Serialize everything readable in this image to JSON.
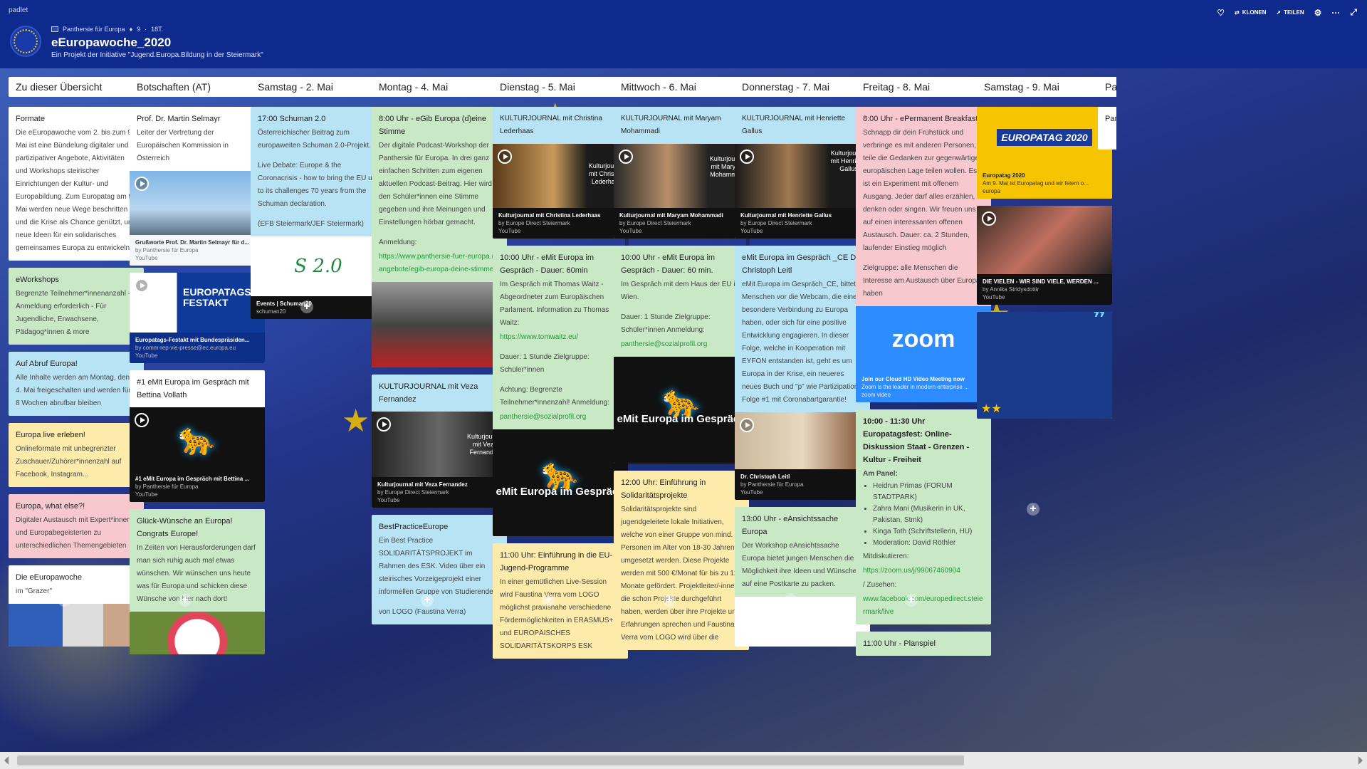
{
  "app": {
    "brand": "padlet"
  },
  "header": {
    "author": "Panthersie für Europa",
    "likes": "9",
    "age": "18T.",
    "title": "eEuropawoche_2020",
    "subtitle": "Ein Projekt der Initiative \"Jugend.Europa.Bildung in der Steiermark\"",
    "actions": {
      "clone": "KLONEN",
      "share": "TEILEN"
    }
  },
  "columns": [
    {
      "title": "Zu dieser Übersicht",
      "cards": [
        {
          "color": "white",
          "title": "Formate",
          "body": "Die eEuropawoche vom 2. bis zum 9. Mai ist eine Bündelung digitaler und partizipativer Angebote, Aktivitäten und Workshops steirischer Einrichtungen der Kultur- und Europabildung. Zum Europatag am 9. Mai werden neue Wege beschritten und die Krise als Chance genützt, um neue Ideen für ein solidarisches gemeinsames Europa zu entwickeln."
        },
        {
          "color": "green",
          "title": "eWorkshops",
          "body": "Begrenzte Teilnehmer*innenanzahl - Anmeldung erforderlich - Für Jugendliche, Erwachsene, Pädagog*innen & more"
        },
        {
          "color": "blue",
          "title": "Auf Abruf Europa!",
          "body": "Alle Inhalte werden am Montag, den 4. Mai freigeschalten und werden für 8 Wochen abrufbar bleiben"
        },
        {
          "color": "yellow",
          "title": "Europa live erleben!",
          "body": "Onlineformate mit unbegrenzter Zuschauer/Zuhörer*innenzahl auf Facebook, Instagram..."
        },
        {
          "color": "pink",
          "title": "Europa, what else?!",
          "body": "Digitaler Austausch mit Expert*innen und Europabegeisterten zu unterschiedlichen Themengebieten"
        },
        {
          "color": "white",
          "title": "Die eEuropawoche",
          "body": "im \"Grazer\""
        }
      ]
    },
    {
      "title": "Botschaften (AT)",
      "cards": [
        {
          "color": "white",
          "title": "Prof. Dr. Martin Selmayr",
          "body": "Leiter der Vertretung der Europäischen Kommission in Österreich",
          "cap_t": "Grußworte Prof. Dr. Martin Selmayr für d...",
          "cap_s1": "by Panthersie für Europa",
          "cap_s2": "YouTube"
        },
        {
          "color": "white",
          "title": "EUROPATAGS-FESTAKT",
          "cap_t": "Europatags-Festakt mit Bundespräsiden...",
          "cap_s1": "by comm-rep-vie-presse@ec.europa.eu",
          "cap_s2": "YouTube"
        },
        {
          "color": "white",
          "title": "#1 eMit Europa im Gespräch mit Bettina Vollath",
          "cap_t": "#1 eMit Europa im Gespräch mit Bettina ...",
          "cap_s1": "by Panthersie für Europa",
          "cap_s2": "YouTube"
        },
        {
          "color": "green",
          "title": "Glück-Wünsche an Europa! Congrats Europe!",
          "body": "In Zeiten von Herausforderungen darf man sich ruhig auch mal etwas wünschen. Wir wünschen uns heute was für Europa und schicken diese Wünsche von hier nach dort!"
        }
      ]
    },
    {
      "title": "Samstag - 2. Mai",
      "cards": [
        {
          "color": "blue",
          "title": "17:00 Schuman 2.0",
          "body": "Österreichischer Beitrag zum europaweiten Schuman 2.0-Projekt.",
          "body2": "Live Debate: Europe & the Coronacrisis - how to bring the EU up to its challenges 70 years from the Schuman declaration.",
          "body3": "(EFB Steiermark/JEF Steiermark)",
          "cap_t": "Events | Schuman20",
          "cap_s1": "schuman20"
        }
      ]
    },
    {
      "title": "Montag - 4. Mai",
      "cards": [
        {
          "color": "green",
          "title": "8:00 Uhr - eGib Europa (d)eine Stimme",
          "body": "Der digitale Podcast-Workshop der Panthersie für Europa. In drei ganz einfachen Schritten zum eigenen aktuellen Podcast-Beitrag. Hier wird den Schüler*innen eine Stimme gegeben und ihre Meinungen und Einstellungen hörbar gemacht.",
          "body2": "Anmeldung:",
          "link": "https://www.panthersie-fuer-europa.at/angebote/egib-europa-deine-stimme/"
        },
        {
          "color": "blue",
          "title": "KULTURJOURNAL mit Veza Fernandez",
          "overlay": "Kulturjournal mit Veza Fernandez",
          "cap_t": "Kulturjournal mit Veza Fernandez",
          "cap_s1": "by Europe Direct Steiermark",
          "cap_s2": "YouTube"
        },
        {
          "color": "blue",
          "title": "BestPracticeEurope",
          "body": "Ein Best Practice SOLIDARITÄTSPROJEKT im Rahmen des ESK. Video über ein steirisches Vorzeigeprojekt einer informellen Gruppe von Studierenden",
          "body2": "von LOGO (Faustina Verra)"
        }
      ]
    },
    {
      "title": "Dienstag - 5. Mai",
      "cards": [
        {
          "color": "blue",
          "title": "KULTURJOURNAL mit Christina Lederhaas",
          "overlay": "Kulturjournal mit Christina Lederhaas",
          "cap_t": "Kulturjournal mit Christina Lederhaas",
          "cap_s1": "by Europe Direct Steiermark",
          "cap_s2": "YouTube"
        },
        {
          "color": "green",
          "title": "10:00 Uhr - eMit Europa im Gespräch - Dauer: 60min",
          "body": "Im Gespräch mit Thomas Waitz - Abgeordneter zum Europäischen Parlament. Information zu Thomas Waitz:",
          "link": "https://www.tomwaitz.eu/",
          "body2": "Dauer: 1 Stunde Zielgruppe: Schüler*innen",
          "body3": "Achtung: Begrenzte Teilnehmer*innenzahl! Anmeldung:",
          "link2": "panthersie@sozialprofil.org",
          "media_text": "eMit Europa im Gespräch"
        },
        {
          "color": "yellow",
          "title": "11:00 Uhr: Einführung in die EU-Jugend-Programme",
          "body": "In einer gemütlichen Live-Session wird Faustina Verra vom LOGO möglichst praxisnahe verschiedene Fördermöglichkeiten in ERASMUS+ und EUROPÄISCHES SOLIDARITÄTSKORPS ESK"
        }
      ]
    },
    {
      "title": "Mittwoch - 6. Mai",
      "cards": [
        {
          "color": "blue",
          "title": "KULTURJOURNAL mit Maryam Mohammadi",
          "overlay": "Kulturjournal mit Maryam Mohammadi",
          "cap_t": "Kulturjournal mit Maryam Mohammadi",
          "cap_s1": "by Europe Direct Steiermark",
          "cap_s2": "YouTube"
        },
        {
          "color": "green",
          "title": "10:00 Uhr - eMit Europa im Gespräch - Dauer: 60 min.",
          "body": "Im Gespräch mit dem Haus der EU in Wien.",
          "body2": "Dauer: 1 Stunde Zielgruppe: Schüler*innen Anmeldung:",
          "link": "panthersie@sozialprofil.org",
          "media_text": "eMit Europa im Gespräch"
        },
        {
          "color": "yellow",
          "title": "12:00 Uhr: Einführung in Solidaritätsprojekte",
          "body": "Solidaritätsprojekte sind jugendgeleitete lokale Initiativen, welche von einer Gruppe von mind. 5 Personen im Alter von 18-30 Jahren umgesetzt werden. Diese Projekte werden mit 500 €/Monat für bis zu 12 Monate gefördert. Projektleiter/-innen, die schon Projekte durchgeführt haben, werden über ihre Projekte und Erfahrungen sprechen und Faustina Verra vom LOGO wird über die"
        }
      ]
    },
    {
      "title": "Donnerstag - 7. Mai",
      "cards": [
        {
          "color": "blue",
          "title": "KULTURJOURNAL mit Henriette Gallus",
          "overlay": "Kulturjournal mit Henriette Gallus",
          "cap_t": "Kulturjournal mit Henriette Gallus",
          "cap_s1": "by Europe Direct Steiermark",
          "cap_s2": "YouTube"
        },
        {
          "color": "blue",
          "title": "eMit Europa im Gespräch _CE Dr. Christoph Leitl",
          "body": "eMit Europa im Gespräch_CE, bittet Menschen vor die Webcam, die eine besondere Verbindung zu Europa haben, oder sich für eine positive Entwicklung engagieren. In dieser Folge, welche in Kooperation mit EYFON entstanden ist, geht es um Europa in der Krise, ein neueres neues Buch und \"p\" wie Partizipation. Folge #1 mit Coronabartgarantie!",
          "cap_t": "Dr. Christoph Leitl",
          "cap_s1": "by Panthersie für Europa",
          "cap_s2": "YouTube"
        },
        {
          "color": "green",
          "title": "13:00 Uhr - eAnsichtssache Europa",
          "body": "Der Workshop eAnsichtssache Europa bietet jungen Menschen die Möglichkeit ihre Ideen und Wünsche auf eine Postkarte zu packen."
        }
      ]
    },
    {
      "title": "Freitag - 8. Mai",
      "cards": [
        {
          "color": "pink",
          "title": "8:00 Uhr - ePermanent Breakfast",
          "body": "Schnapp dir dein Frühstück und verbringe es mit anderen Personen, teile die Gedanken zur gegenwärtigen europäischen Lage teilen wollen. Es ist ein Experiment mit offenem Ausgang. Jeder darf alles erzählen, denken oder singen. Wir freuen uns auf einen interessanten offenen Austausch. Dauer: ca. 2 Stunden, laufender Einstieg möglich",
          "body2": "Zielgruppe: alle Menschen die Interesse am Austausch über Europa haben",
          "zoom": "zoom",
          "cap_t": "Join our Cloud HD Video Meeting now",
          "cap_s1": "Zoom is the leader in modern enterprise ...",
          "cap_s2": "zoom video"
        },
        {
          "color": "green",
          "title": "10:00 - 11:30 Uhr Europatagsfest: Online-Diskussion Staat - Grenzen - Kultur - Freiheit",
          "body": "Am Panel:",
          "list": [
            "Heidrun Primas (FORUM STADTPARK)",
            "Zahra Mani (Musikerin in UK, Pakistan, Stmk)",
            "Kinga Toth (Schriftstellerin, HU)",
            "Moderation: David Röthler"
          ],
          "body2": "Mitdiskutieren:",
          "link": "https://zoom.us/j/99067460904",
          "body3": "/ Zusehen:",
          "link2": "www.facebook.com/europedirect.steiermark/live"
        },
        {
          "color": "green",
          "title": "11:00 Uhr - Planspiel"
        }
      ]
    },
    {
      "title": "Samstag - 9. Mai",
      "cards": [
        {
          "color": "white",
          "title": "EUROPATAG 2020",
          "cap_t": "Europatag 2020",
          "cap_s1": "Am 9. Mai ist Europatag und wir feiern o...",
          "cap_s2": "europa"
        },
        {
          "color": "white",
          "title": "DIE VIELEN - WIR SIND VIELE, WERDEN ...",
          "cap_t": "DIE VIELEN - WIR SIND VIELE, WERDEN ...",
          "cap_s1": "by Annika Stridysdottir",
          "cap_s2": "YouTube"
        },
        {
          "color": "white",
          "title": "Quote"
        }
      ]
    },
    {
      "title": "Pa",
      "cards": [
        {
          "color": "white",
          "title": "Par"
        }
      ]
    }
  ]
}
